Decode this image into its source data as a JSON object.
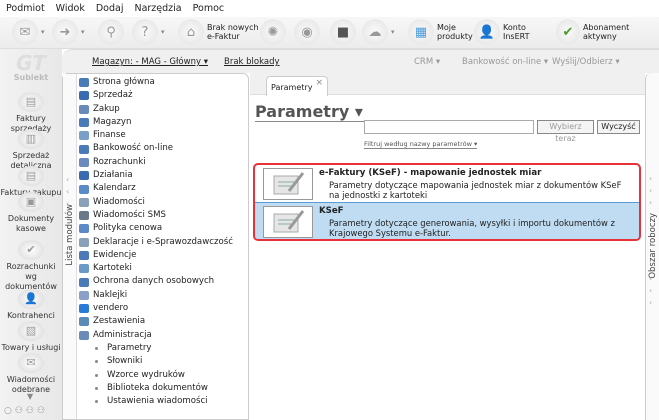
{
  "menu": [
    "Podmiot",
    "Widok",
    "Dodaj",
    "Narzędzia",
    "Pomoc"
  ],
  "toolbar": {
    "efaktury": "Brak nowych\ne-Faktur",
    "products": "Moje\nprodukty",
    "account": "Konto\nInsERT",
    "subscription": "Abonament aktywny",
    "insert_badge": "InsERT"
  },
  "logo": {
    "text": "Subiekt",
    "mark": "GT"
  },
  "sidebar": [
    "Faktury sprzedaży",
    "Sprzedaż detaliczna",
    "Faktury zakupu",
    "Dokumenty kasowe",
    "Rozrachunki wg dokumentów",
    "Kontrahenci",
    "Towary i usługi",
    "Wiadomości odebrane"
  ],
  "subbar": {
    "warehouse": "Magazyn: - MAG - Główny ▾",
    "lock": "Brak blokady",
    "crm": "CRM ▾",
    "bank": "Bankowość on-line ▾",
    "send": "Wyślij/Odbierz ▾"
  },
  "modules_label": "Lista modułów",
  "modules": [
    "Strona główna",
    "Sprzedaż",
    "Zakup",
    "Magazyn",
    "Finanse",
    "Bankowość on-line",
    "Rozrachunki",
    "Działania",
    "Kalendarz",
    "Wiadomości",
    "Wiadomości SMS",
    "Polityka cenowa",
    "Deklaracje i e-Sprawozdawczość",
    "Ewidencje",
    "Kartoteki",
    "Ochrona danych osobowych",
    "Naklejki",
    "vendero",
    "Zestawienia",
    "Administracja"
  ],
  "admin_sub": [
    "Parametry",
    "Słowniki",
    "Wzorce wydruków",
    "Biblioteka dokumentów",
    "Ustawienia wiadomości"
  ],
  "tab": {
    "label": "Parametry",
    "close": "×"
  },
  "page_title": "Parametry ▾",
  "search": {
    "value": "",
    "select_btn": "Wybierz teraz",
    "clear_btn": "Wyczyść",
    "filter": "Filtruj według nazwy parametrów ▾"
  },
  "results": [
    {
      "title": "e-Faktury (KSeF) - mapowanie jednostek miar",
      "desc": "Parametry dotyczące mapowania jednostek miar z dokumentów KSeF na jednostki z kartoteki",
      "selected": false
    },
    {
      "title": "KSeF",
      "desc": "Parametry dotyczące generowania, wysyłki i importu dokumentów z Krajowego Systemu e-Faktur.",
      "selected": true
    }
  ],
  "right_panel": "Obszar roboczy",
  "colors": {
    "highlight_border": "#e8323a",
    "selected_row": "#bfdcf2"
  }
}
